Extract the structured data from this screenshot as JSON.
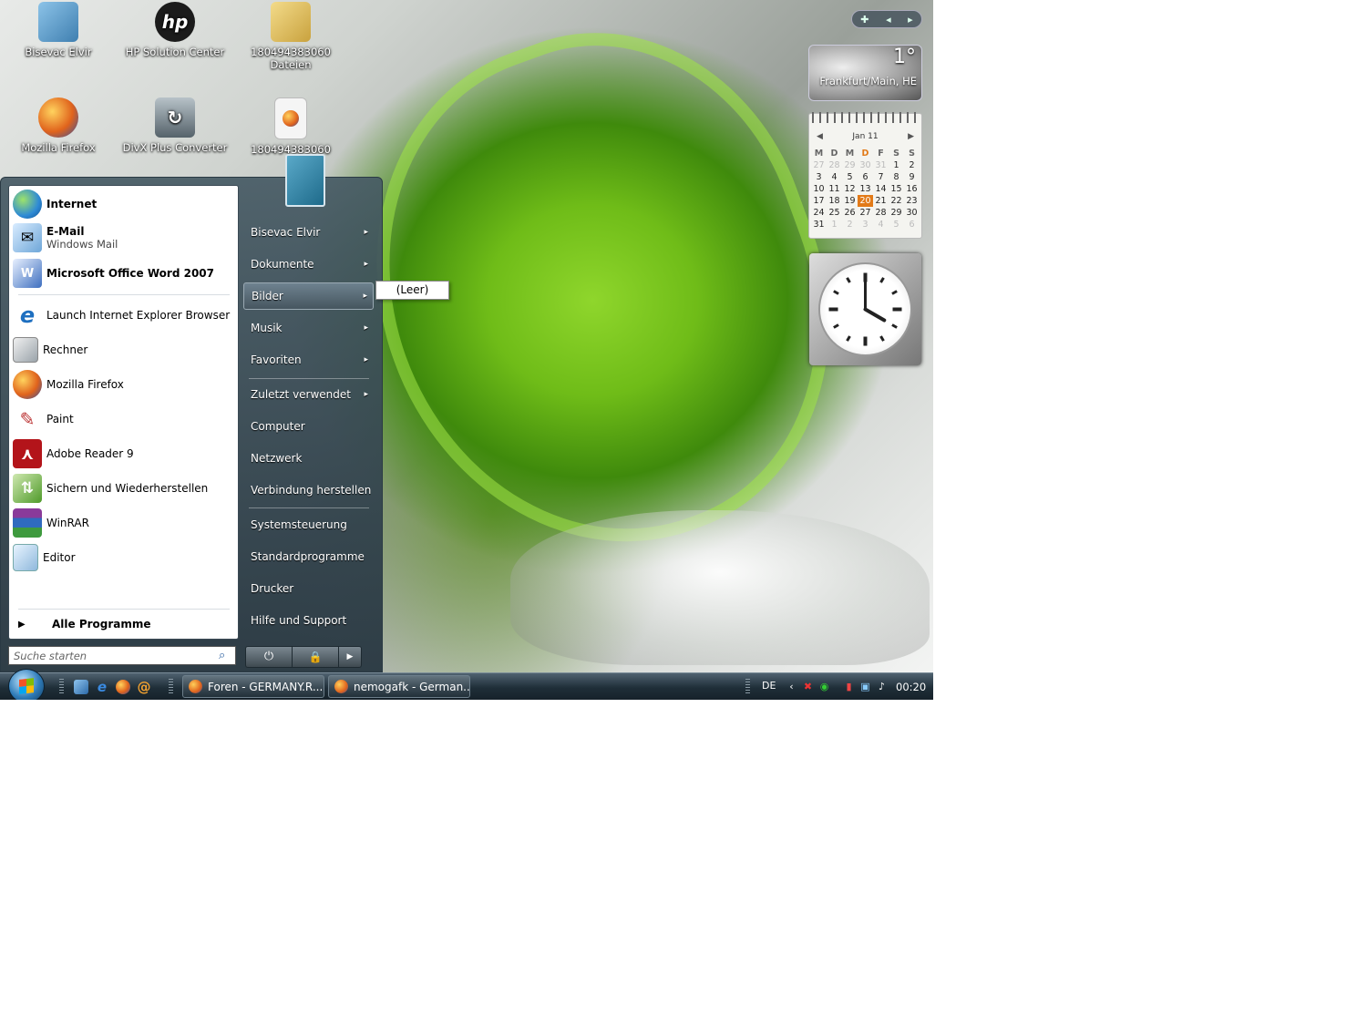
{
  "desktop": {
    "icons": [
      {
        "label": "Bisevac Elvir",
        "icon": "user-folder-icon",
        "color": "#6aa7d6"
      },
      {
        "label": "HP Solution Center",
        "icon": "hp-logo-icon",
        "color": "#222222"
      },
      {
        "label": "180494383060 Dateien",
        "icon": "folder-icon",
        "color": "#e6c66a"
      },
      {
        "label": "Mozilla Firefox",
        "icon": "firefox-icon",
        "color": "#e0631c"
      },
      {
        "label": "DivX Plus Converter",
        "icon": "divx-converter-icon",
        "color": "#6d7a82"
      },
      {
        "label": "180494383060",
        "icon": "firefox-document-icon",
        "color": "#f1f1f1"
      }
    ]
  },
  "start_menu": {
    "pinned": [
      {
        "title": "Internet",
        "subtitle": "",
        "icon": "globe-icon"
      },
      {
        "title": "E-Mail",
        "subtitle": "Windows Mail",
        "icon": "mail-icon"
      },
      {
        "title": "Microsoft Office Word 2007",
        "subtitle": "",
        "icon": "word-icon"
      }
    ],
    "recent": [
      {
        "label": "Launch Internet Explorer Browser",
        "icon": "ie-icon"
      },
      {
        "label": "Rechner",
        "icon": "calculator-icon"
      },
      {
        "label": "Mozilla Firefox",
        "icon": "firefox-icon"
      },
      {
        "label": "Paint",
        "icon": "paint-icon"
      },
      {
        "label": "Adobe Reader 9",
        "icon": "adobe-reader-icon"
      },
      {
        "label": "Sichern und Wiederherstellen",
        "icon": "backup-icon"
      },
      {
        "label": "WinRAR",
        "icon": "winrar-icon"
      },
      {
        "label": "Editor",
        "icon": "notepad-icon"
      }
    ],
    "all_programs": "Alle Programme",
    "search_placeholder": "Suche starten",
    "right_items": [
      {
        "label": "Bisevac Elvir",
        "arrow": "▸"
      },
      {
        "label": "Dokumente",
        "arrow": "▸"
      },
      {
        "label": "Bilder",
        "arrow": "▸"
      },
      {
        "label": "Musik",
        "arrow": "▸"
      },
      {
        "label": "Favoriten",
        "arrow": "▸"
      },
      {
        "label": "Zuletzt verwendet",
        "arrow": "▸"
      },
      {
        "label": "Computer",
        "arrow": ""
      },
      {
        "label": "Netzwerk",
        "arrow": ""
      },
      {
        "label": "Verbindung herstellen",
        "arrow": ""
      },
      {
        "label": "Systemsteuerung",
        "arrow": ""
      },
      {
        "label": "Standardprogramme",
        "arrow": ""
      },
      {
        "label": "Drucker",
        "arrow": ""
      },
      {
        "label": "Hilfe und Support",
        "arrow": ""
      }
    ],
    "highlighted_item": "Bilder",
    "submenu_label": "(Leer)"
  },
  "gadgets": {
    "weather": {
      "temperature": "1°",
      "location": "Frankfurt/Main, HE"
    },
    "calendar": {
      "month": "Jan 11",
      "weekdays": [
        "M",
        "D",
        "M",
        "D",
        "F",
        "S",
        "S"
      ],
      "weeks": [
        [
          "27",
          "28",
          "29",
          "30",
          "31",
          "1",
          "2"
        ],
        [
          "3",
          "4",
          "5",
          "6",
          "7",
          "8",
          "9"
        ],
        [
          "10",
          "11",
          "12",
          "13",
          "14",
          "15",
          "16"
        ],
        [
          "17",
          "18",
          "19",
          "20",
          "21",
          "22",
          "23"
        ],
        [
          "24",
          "25",
          "26",
          "27",
          "28",
          "29",
          "30"
        ],
        [
          "31",
          "1",
          "2",
          "3",
          "4",
          "5",
          "6"
        ]
      ],
      "today": "20",
      "accent": "#e27a18"
    },
    "clock": {
      "hour": 4,
      "minute": 0
    }
  },
  "taskbar": {
    "windows": [
      {
        "label": "Foren - GERMANY.R..."
      },
      {
        "label": "nemogafk - German..."
      }
    ],
    "tray": {
      "language": "DE",
      "time": "00:20"
    }
  }
}
